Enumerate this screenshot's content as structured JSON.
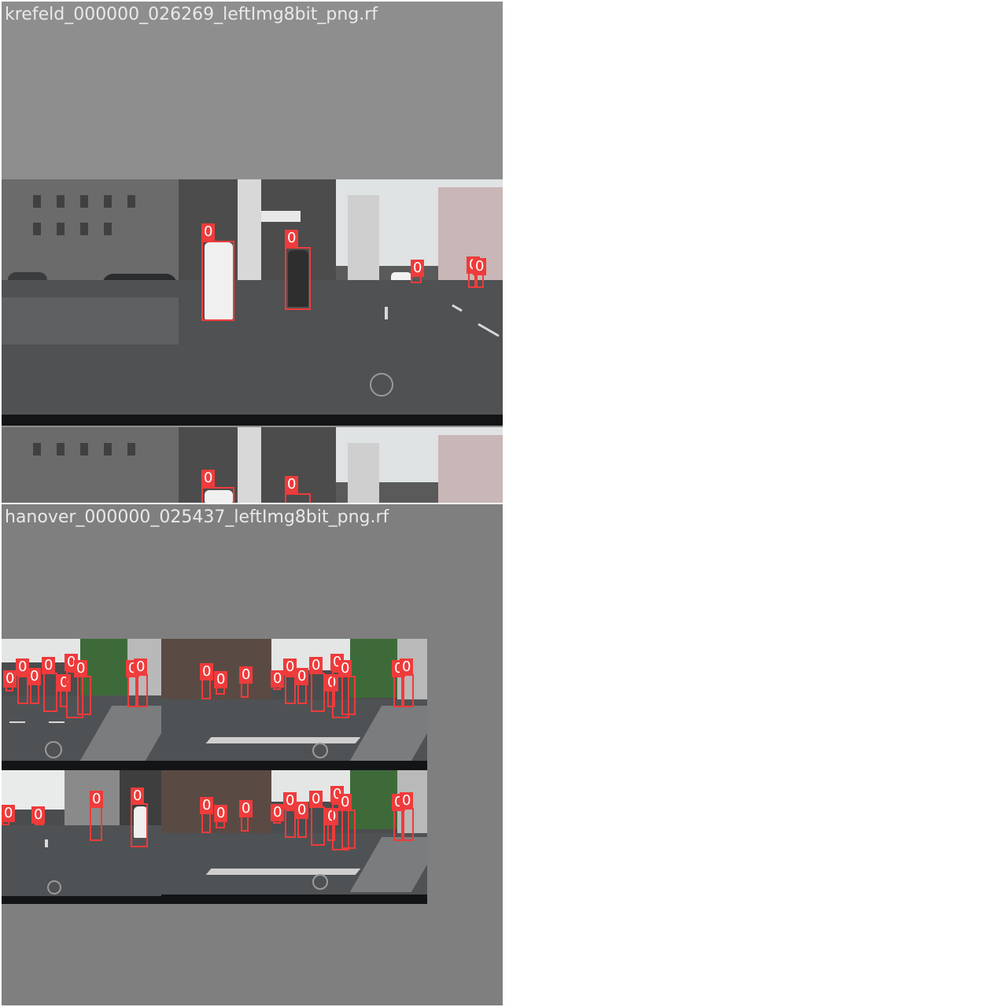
{
  "tiles": [
    {
      "title": "krefeld_000000_026269_leftImg8bit_png.rf",
      "background": "#8e8e8e"
    },
    {
      "title": "hanover_000000_025437_leftImg8bit_png.rf",
      "background": "#7f7f7f"
    }
  ],
  "detection_label": "0",
  "colors": {
    "box": "#ef3b3b",
    "label_text": "#ffffff",
    "title_text": "#e9e9e9"
  }
}
